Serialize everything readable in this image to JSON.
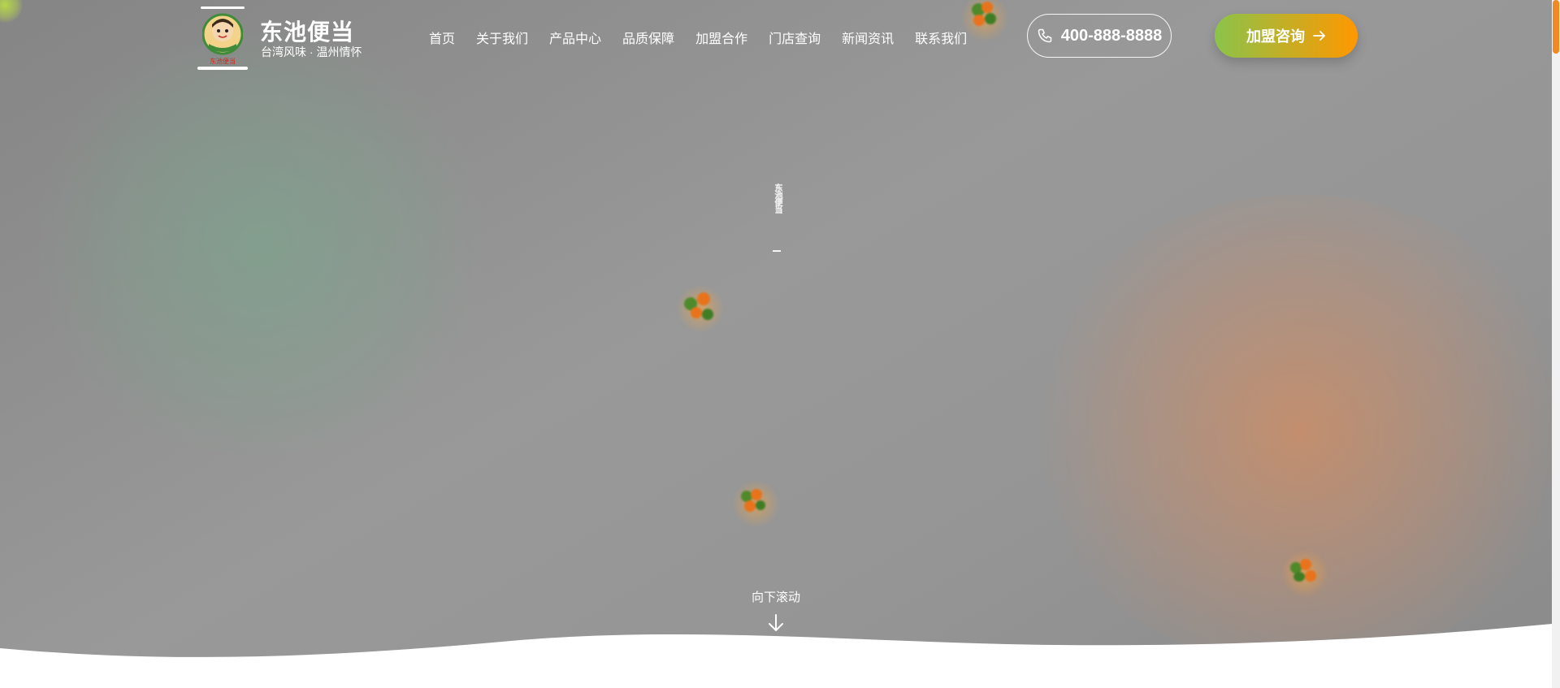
{
  "brand": {
    "title": "东池便当",
    "subtitle": "台湾风味 · 温州情怀",
    "logo_text": "东池便当"
  },
  "nav": {
    "items": [
      {
        "label": "首页"
      },
      {
        "label": "关于我们"
      },
      {
        "label": "产品中心"
      },
      {
        "label": "品质保障"
      },
      {
        "label": "加盟合作"
      },
      {
        "label": "门店查询"
      },
      {
        "label": "新闻资讯"
      },
      {
        "label": "联系我们"
      }
    ]
  },
  "header": {
    "phone": "400-888-8888",
    "phone_icon": "phone-icon",
    "join_label": "加盟咨询",
    "join_icon": "arrow-right-icon"
  },
  "hero": {
    "vertical_text": "东池便当",
    "scroll_label": "向下滚动",
    "scroll_icon": "arrow-down-icon"
  },
  "colors": {
    "accent_green": "#8bc34a",
    "accent_orange": "#ff9800",
    "scroll_thumb": "#f08a24"
  }
}
